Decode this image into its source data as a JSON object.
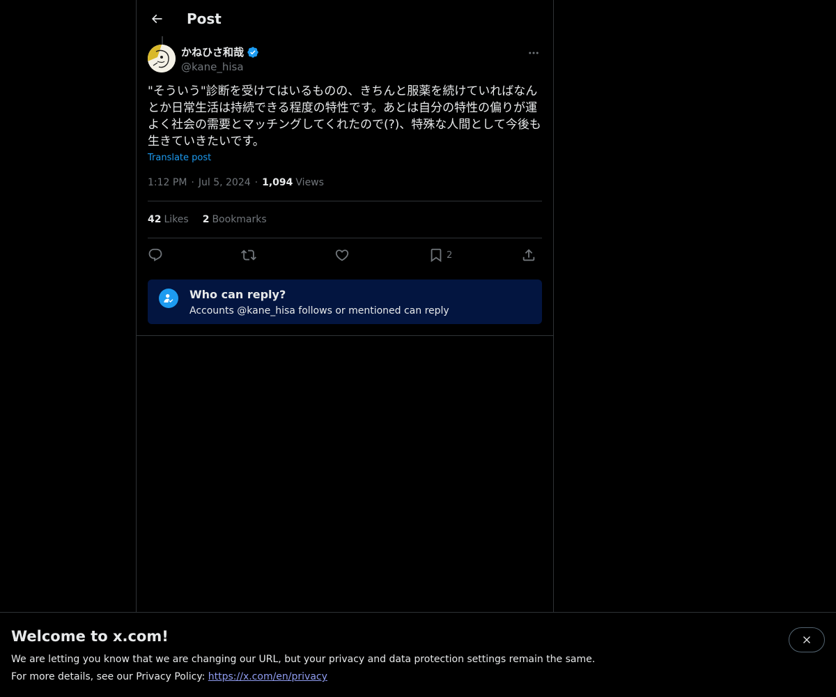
{
  "header": {
    "title": "Post",
    "back_icon": "arrow-left-icon"
  },
  "post": {
    "author": {
      "display_name": "かねひさ和哉",
      "handle": "@kane_hisa",
      "verified": true,
      "verified_color": "#1d9bf0"
    },
    "text": "\"そういう\"診断を受けてはいるものの、きちんと服薬を続けていればなんとか日常生活は持続できる程度の特性です。あとは自分の特性の偏りが運よく社会の需要とマッチングしてくれたので(?)、特殊な人間として今後も生きていきたいです。",
    "translate_label": "Translate post",
    "time": "1:12 PM",
    "separator": "·",
    "date": "Jul 5, 2024",
    "views_count": "1,094",
    "views_label": "Views",
    "likes_count": "42",
    "likes_label": "Likes",
    "bookmarks_count": "2",
    "bookmarks_label": "Bookmarks",
    "actions": {
      "reply_icon": "reply-icon",
      "repost_icon": "repost-icon",
      "like_icon": "heart-icon",
      "bookmark_icon": "bookmark-icon",
      "bookmark_count": "2",
      "share_icon": "share-icon"
    }
  },
  "reply_restriction": {
    "title": "Who can reply?",
    "subtitle": "Accounts @kane_hisa follows or mentioned can reply",
    "icon": "person-check-icon",
    "background": "#031540"
  },
  "banner": {
    "title": "Welcome to x.com!",
    "line1": "We are letting you know that we are changing our URL, but your privacy and data protection settings remain the same.",
    "line2_prefix": "For more details, see our Privacy Policy: ",
    "link": "https://x.com/en/privacy",
    "close_icon": "close-icon"
  },
  "colors": {
    "background": "#000000",
    "text_primary": "#e7e9ea",
    "text_secondary": "#71767b",
    "accent": "#1d9bf0",
    "border": "#2f3336"
  }
}
